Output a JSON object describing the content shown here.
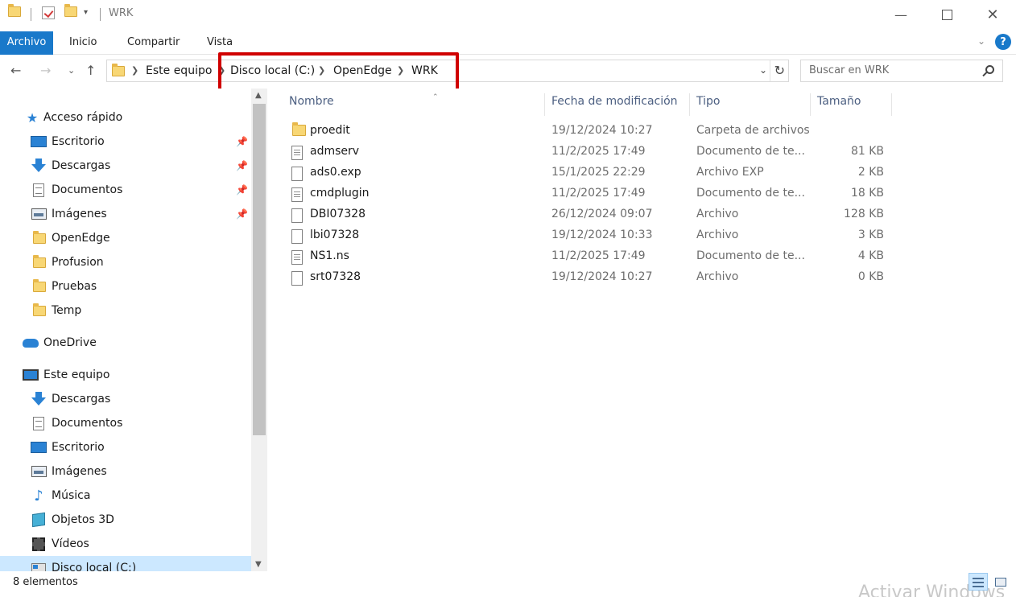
{
  "window": {
    "title": "WRK",
    "minimize_icon": "minimize-icon",
    "maximize_icon": "maximize-icon",
    "close_icon": "close-icon"
  },
  "ribbon": {
    "tabs": [
      "Archivo",
      "Inicio",
      "Compartir",
      "Vista"
    ],
    "help": "?"
  },
  "address": {
    "crumbs": [
      "Este equipo",
      "Disco local (C:)",
      "OpenEdge",
      "WRK"
    ],
    "search_placeholder": "Buscar en WRK"
  },
  "nav": {
    "quick_access": {
      "label": "Acceso rápido",
      "items": [
        {
          "label": "Escritorio",
          "icon": "desktop-icon",
          "pinned": true
        },
        {
          "label": "Descargas",
          "icon": "download-icon",
          "pinned": true
        },
        {
          "label": "Documentos",
          "icon": "document-icon",
          "pinned": true
        },
        {
          "label": "Imágenes",
          "icon": "pictures-icon",
          "pinned": true
        },
        {
          "label": "OpenEdge",
          "icon": "folder-icon",
          "pinned": false
        },
        {
          "label": "Profusion",
          "icon": "folder-icon",
          "pinned": false
        },
        {
          "label": "Pruebas",
          "icon": "folder-icon",
          "pinned": false
        },
        {
          "label": "Temp",
          "icon": "folder-icon",
          "pinned": false
        }
      ]
    },
    "onedrive": "OneDrive",
    "this_pc": {
      "label": "Este equipo",
      "items": [
        {
          "label": "Descargas",
          "icon": "download-icon"
        },
        {
          "label": "Documentos",
          "icon": "document-icon"
        },
        {
          "label": "Escritorio",
          "icon": "desktop-icon"
        },
        {
          "label": "Imágenes",
          "icon": "pictures-icon"
        },
        {
          "label": "Música",
          "icon": "music-icon"
        },
        {
          "label": "Objetos 3D",
          "icon": "3d-objects-icon"
        },
        {
          "label": "Vídeos",
          "icon": "videos-icon"
        },
        {
          "label": "Disco local (C:)",
          "icon": "drive-icon"
        }
      ]
    }
  },
  "columns": [
    "Nombre",
    "Fecha de modificación",
    "Tipo",
    "Tamaño"
  ],
  "files": [
    {
      "name": "proedit",
      "date": "19/12/2024 10:27",
      "type": "Carpeta de archivos",
      "size": "",
      "icon": "folder-icon"
    },
    {
      "name": "admserv",
      "date": "11/2/2025 17:49",
      "type": "Documento de te...",
      "size": "81 KB",
      "icon": "text-file-icon"
    },
    {
      "name": "ads0.exp",
      "date": "15/1/2025 22:29",
      "type": "Archivo EXP",
      "size": "2 KB",
      "icon": "file-icon"
    },
    {
      "name": "cmdplugin",
      "date": "11/2/2025 17:49",
      "type": "Documento de te...",
      "size": "18 KB",
      "icon": "text-file-icon"
    },
    {
      "name": "DBI07328",
      "date": "26/12/2024 09:07",
      "type": "Archivo",
      "size": "128 KB",
      "icon": "file-icon"
    },
    {
      "name": "lbi07328",
      "date": "19/12/2024 10:33",
      "type": "Archivo",
      "size": "3 KB",
      "icon": "file-icon"
    },
    {
      "name": "NS1.ns",
      "date": "11/2/2025 17:49",
      "type": "Documento de te...",
      "size": "4 KB",
      "icon": "text-file-icon"
    },
    {
      "name": "srt07328",
      "date": "19/12/2024 10:27",
      "type": "Archivo",
      "size": "0 KB",
      "icon": "file-icon"
    }
  ],
  "status": {
    "count": "8 elementos",
    "watermark": "Activar Windows"
  },
  "colors": {
    "accent": "#1979ca",
    "selection": "#cce8ff",
    "highlight_box": "#d00000"
  }
}
